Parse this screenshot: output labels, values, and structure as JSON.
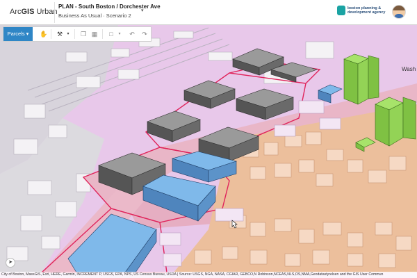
{
  "header": {
    "app_title_prefix": "Arc",
    "app_title_bold": "GIS",
    "app_title_suffix": " Urban",
    "plan_title": "PLAN - South Boston / Dorchester Ave",
    "scenario": "Business As Usual · Scenario 2",
    "dropdown_icon": "chevron-down-icon",
    "logo_line1": "boston planning &",
    "logo_line2": "development agency"
  },
  "toolbar": {
    "parcels_label": "Parcels ▾",
    "icons": [
      "hand-icon",
      "wrench-icon",
      "copy-icon",
      "grid-icon",
      "shape-icon",
      "undo-icon",
      "redo-icon"
    ]
  },
  "map": {
    "street_label": "Wash",
    "attribution": "City of Boston, MassGIS, Esri, HERE, Garmin, INCREMENT P, USGS, EPA, NPS, US Census Bureau, USDA | Source: USGS, NGA, NASA, CGIAR, GEBCO,N Robinson,NCEAS,NLS,OS,NMA,Geodatastyrelsen and the GIS User Commun",
    "colors": {
      "zone_pink": "#e9c9ea",
      "parcel_line": "#e0245b",
      "building_gray": "#808080",
      "building_blue": "#79b6e8",
      "building_green": "#8fd14f",
      "context_orange": "#e9b792"
    }
  }
}
